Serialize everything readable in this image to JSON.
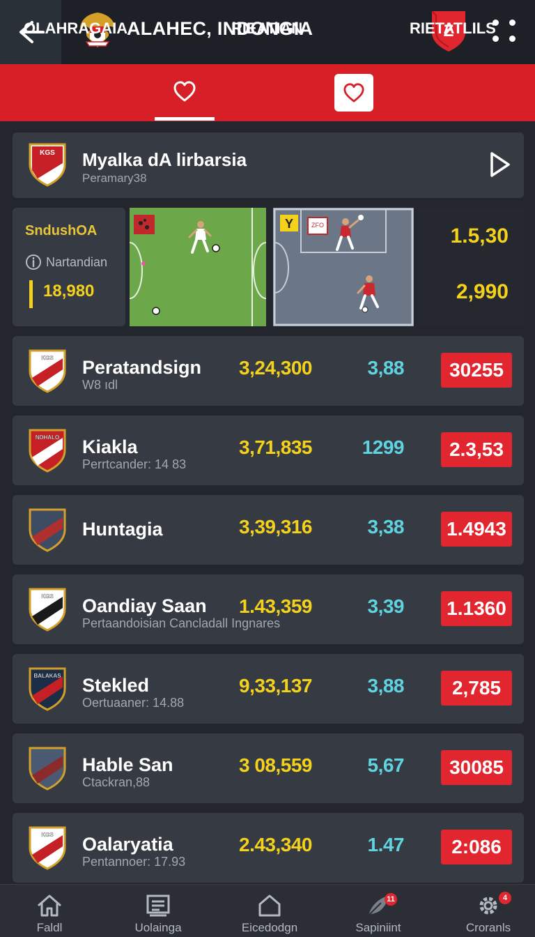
{
  "header": {
    "title": "ALAHEC, INDONGIA",
    "brand_text": "Z"
  },
  "tabs": [
    {
      "label": "OLAHRAGAIA"
    },
    {
      "label": "RIEATIAN"
    },
    {
      "label": "RIETATLILS"
    }
  ],
  "featured": {
    "crest_text": "KGS",
    "title": "Myalka dA lirbarsia",
    "subtitle": "Peramary38"
  },
  "match": {
    "league": "SndushOA",
    "venue": "Nartandian",
    "count": "18,980",
    "odds": [
      "1.5,30",
      "2,990"
    ],
    "pitch_sign": "Y",
    "pitch_label": "ZFO"
  },
  "rows": [
    {
      "crest_text": "KGS",
      "name": "Peratandsign",
      "meta": "W8 ıdl",
      "v1": "3,24,300",
      "v2": "3,88",
      "badge": "30255"
    },
    {
      "crest_text": "NDHALO",
      "name": "Kiakla",
      "meta": "Perrtcander: 14 83",
      "v1": "3,71,835",
      "v2": "1299",
      "badge": "2.3,53"
    },
    {
      "crest_text": "",
      "name": "Huntagia",
      "meta": "",
      "v1": "3,39,316",
      "v2": "3,38",
      "badge": "1.4943"
    },
    {
      "crest_text": "KGS",
      "name": "Oandiay Saan",
      "meta": "Pertaandoisian Cancladall Ingnares",
      "v1": "1.43,359",
      "v2": "3,39",
      "badge": "1.1360"
    },
    {
      "crest_text": "BALAKAS",
      "name": "Stekled",
      "meta": "Oertuaaner: 14.88",
      "v1": "9,33,137",
      "v2": "3,88",
      "badge": "2,785"
    },
    {
      "crest_text": "",
      "name": "Hable San",
      "meta": "Ctackran,88",
      "v1": "3 08,559",
      "v2": "5,67",
      "badge": "30085"
    },
    {
      "crest_text": "KGS",
      "name": "Oalaryatia",
      "meta": "Pentannoer: 17.93",
      "v1": "2.43,340",
      "v2": "1.47",
      "badge": "2:086"
    }
  ],
  "nav": [
    {
      "label": "Faldl",
      "icon": "home-icon"
    },
    {
      "label": "Uolainga",
      "icon": "list-icon"
    },
    {
      "label": "Eicedodgn",
      "icon": "house-outline-icon"
    },
    {
      "label": "Sapiniint",
      "icon": "feather-icon",
      "badge": "11"
    },
    {
      "label": "Croranls",
      "icon": "gear-icon",
      "badge": "4"
    }
  ],
  "colors": {
    "accent_red": "#d71f28",
    "value_yellow": "#f4d21c",
    "value_cyan": "#5fd4e0",
    "card": "#353a43",
    "background": "#23262d"
  }
}
